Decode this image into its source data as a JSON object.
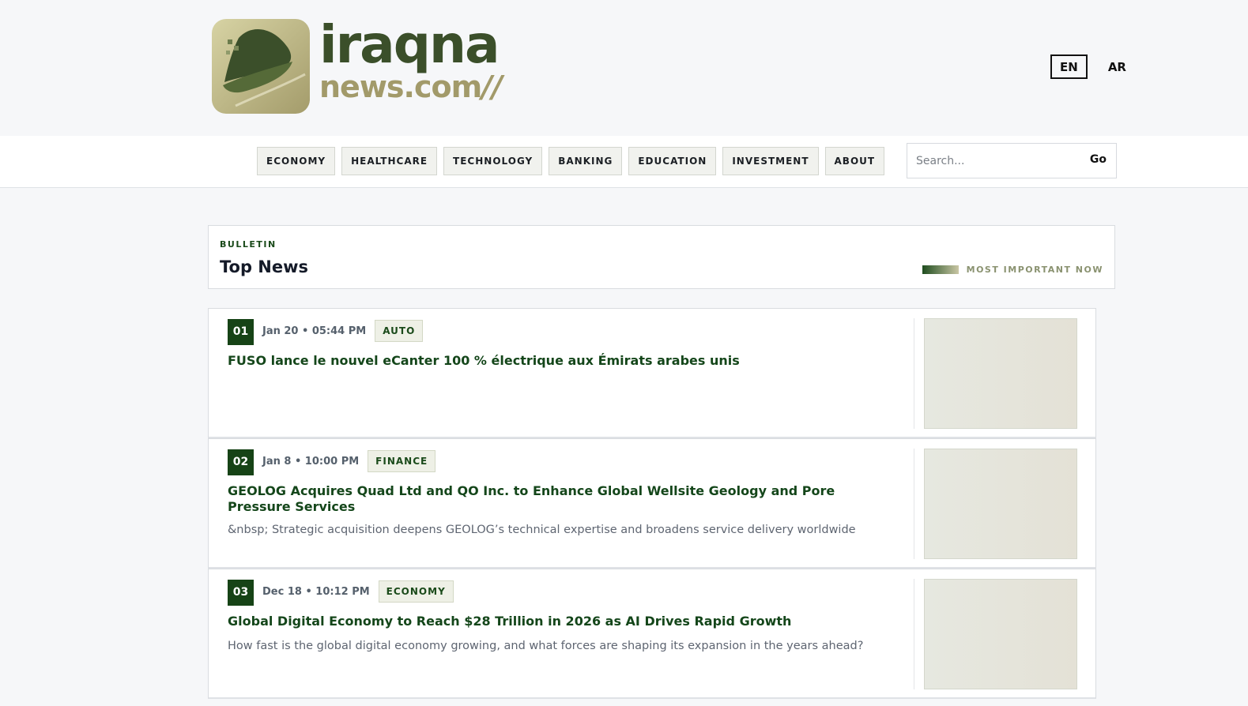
{
  "header": {
    "logo": {
      "main": "iraqna",
      "sub": "news.com",
      "slashes": "//"
    },
    "languages": [
      {
        "label": "EN",
        "active": true
      },
      {
        "label": "AR",
        "active": false
      }
    ]
  },
  "nav": {
    "items": [
      "ECONOMY",
      "HEALTHCARE",
      "TECHNOLOGY",
      "BANKING",
      "EDUCATION",
      "INVESTMENT",
      "ABOUT"
    ]
  },
  "search": {
    "placeholder": "Search...",
    "go_label": "Go"
  },
  "bulletin": {
    "kicker": "BULLETIN",
    "title": "Top News",
    "tag": "MOST IMPORTANT NOW"
  },
  "articles": [
    {
      "rank": "01",
      "date": "Jan 20 • 05:44 PM",
      "category": "AUTO",
      "title": "FUSO lance le nouvel eCanter 100 % électrique aux Émirats arabes unis",
      "desc": ""
    },
    {
      "rank": "02",
      "date": "Jan 8 • 10:00 PM",
      "category": "FINANCE",
      "title": "GEOLOG Acquires Quad Ltd and QO Inc. to Enhance Global Wellsite Geology and Pore Pressure Services",
      "desc": "&nbsp; Strategic acquisition deepens GEOLOG’s technical expertise and broadens service delivery worldwide"
    },
    {
      "rank": "03",
      "date": "Dec 18 • 10:12 PM",
      "category": "ECONOMY",
      "title": "Global Digital Economy to Reach $28 Trillion in 2026 as AI Drives Rapid Growth",
      "desc": "How fast is the global digital economy growing, and what forces are shaping its expansion in the years ahead?"
    }
  ],
  "colors": {
    "brand_green": "#164316",
    "brand_gold": "#a29a6a"
  }
}
